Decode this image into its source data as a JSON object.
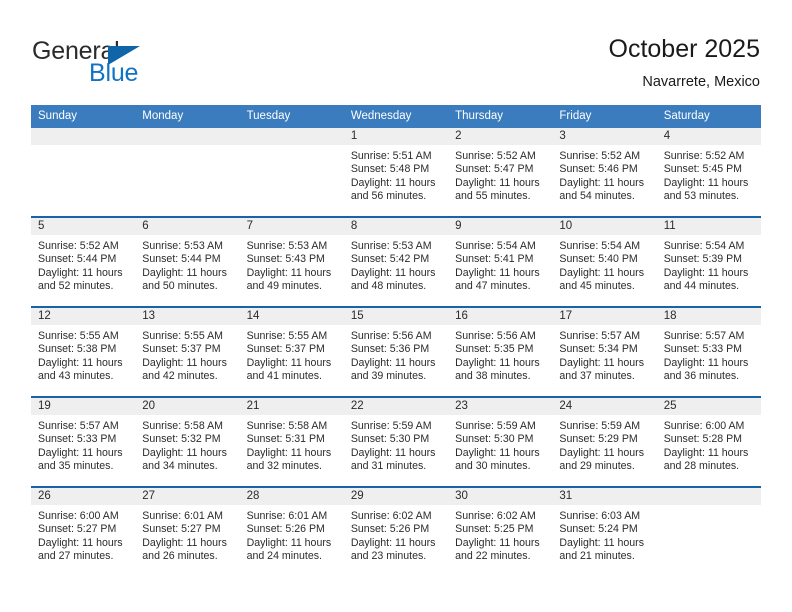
{
  "brand": {
    "word1": "General",
    "word2": "Blue",
    "triangle_icon": "triangle-icon"
  },
  "header": {
    "title": "October 2025",
    "location": "Navarrete, Mexico"
  },
  "calendar": {
    "weekday_headers": [
      "Sunday",
      "Monday",
      "Tuesday",
      "Wednesday",
      "Thursday",
      "Friday",
      "Saturday"
    ],
    "labels": {
      "sunrise_prefix": "Sunrise:",
      "sunset_prefix": "Sunset:",
      "daylight_prefix": "Daylight:"
    },
    "weeks": [
      [
        {
          "day": "",
          "sunrise": "",
          "sunset": "",
          "daylight_line1": "",
          "daylight_line2": ""
        },
        {
          "day": "",
          "sunrise": "",
          "sunset": "",
          "daylight_line1": "",
          "daylight_line2": ""
        },
        {
          "day": "",
          "sunrise": "",
          "sunset": "",
          "daylight_line1": "",
          "daylight_line2": ""
        },
        {
          "day": "1",
          "sunrise": "Sunrise: 5:51 AM",
          "sunset": "Sunset: 5:48 PM",
          "daylight_line1": "Daylight: 11 hours",
          "daylight_line2": "and 56 minutes."
        },
        {
          "day": "2",
          "sunrise": "Sunrise: 5:52 AM",
          "sunset": "Sunset: 5:47 PM",
          "daylight_line1": "Daylight: 11 hours",
          "daylight_line2": "and 55 minutes."
        },
        {
          "day": "3",
          "sunrise": "Sunrise: 5:52 AM",
          "sunset": "Sunset: 5:46 PM",
          "daylight_line1": "Daylight: 11 hours",
          "daylight_line2": "and 54 minutes."
        },
        {
          "day": "4",
          "sunrise": "Sunrise: 5:52 AM",
          "sunset": "Sunset: 5:45 PM",
          "daylight_line1": "Daylight: 11 hours",
          "daylight_line2": "and 53 minutes."
        }
      ],
      [
        {
          "day": "5",
          "sunrise": "Sunrise: 5:52 AM",
          "sunset": "Sunset: 5:44 PM",
          "daylight_line1": "Daylight: 11 hours",
          "daylight_line2": "and 52 minutes."
        },
        {
          "day": "6",
          "sunrise": "Sunrise: 5:53 AM",
          "sunset": "Sunset: 5:44 PM",
          "daylight_line1": "Daylight: 11 hours",
          "daylight_line2": "and 50 minutes."
        },
        {
          "day": "7",
          "sunrise": "Sunrise: 5:53 AM",
          "sunset": "Sunset: 5:43 PM",
          "daylight_line1": "Daylight: 11 hours",
          "daylight_line2": "and 49 minutes."
        },
        {
          "day": "8",
          "sunrise": "Sunrise: 5:53 AM",
          "sunset": "Sunset: 5:42 PM",
          "daylight_line1": "Daylight: 11 hours",
          "daylight_line2": "and 48 minutes."
        },
        {
          "day": "9",
          "sunrise": "Sunrise: 5:54 AM",
          "sunset": "Sunset: 5:41 PM",
          "daylight_line1": "Daylight: 11 hours",
          "daylight_line2": "and 47 minutes."
        },
        {
          "day": "10",
          "sunrise": "Sunrise: 5:54 AM",
          "sunset": "Sunset: 5:40 PM",
          "daylight_line1": "Daylight: 11 hours",
          "daylight_line2": "and 45 minutes."
        },
        {
          "day": "11",
          "sunrise": "Sunrise: 5:54 AM",
          "sunset": "Sunset: 5:39 PM",
          "daylight_line1": "Daylight: 11 hours",
          "daylight_line2": "and 44 minutes."
        }
      ],
      [
        {
          "day": "12",
          "sunrise": "Sunrise: 5:55 AM",
          "sunset": "Sunset: 5:38 PM",
          "daylight_line1": "Daylight: 11 hours",
          "daylight_line2": "and 43 minutes."
        },
        {
          "day": "13",
          "sunrise": "Sunrise: 5:55 AM",
          "sunset": "Sunset: 5:37 PM",
          "daylight_line1": "Daylight: 11 hours",
          "daylight_line2": "and 42 minutes."
        },
        {
          "day": "14",
          "sunrise": "Sunrise: 5:55 AM",
          "sunset": "Sunset: 5:37 PM",
          "daylight_line1": "Daylight: 11 hours",
          "daylight_line2": "and 41 minutes."
        },
        {
          "day": "15",
          "sunrise": "Sunrise: 5:56 AM",
          "sunset": "Sunset: 5:36 PM",
          "daylight_line1": "Daylight: 11 hours",
          "daylight_line2": "and 39 minutes."
        },
        {
          "day": "16",
          "sunrise": "Sunrise: 5:56 AM",
          "sunset": "Sunset: 5:35 PM",
          "daylight_line1": "Daylight: 11 hours",
          "daylight_line2": "and 38 minutes."
        },
        {
          "day": "17",
          "sunrise": "Sunrise: 5:57 AM",
          "sunset": "Sunset: 5:34 PM",
          "daylight_line1": "Daylight: 11 hours",
          "daylight_line2": "and 37 minutes."
        },
        {
          "day": "18",
          "sunrise": "Sunrise: 5:57 AM",
          "sunset": "Sunset: 5:33 PM",
          "daylight_line1": "Daylight: 11 hours",
          "daylight_line2": "and 36 minutes."
        }
      ],
      [
        {
          "day": "19",
          "sunrise": "Sunrise: 5:57 AM",
          "sunset": "Sunset: 5:33 PM",
          "daylight_line1": "Daylight: 11 hours",
          "daylight_line2": "and 35 minutes."
        },
        {
          "day": "20",
          "sunrise": "Sunrise: 5:58 AM",
          "sunset": "Sunset: 5:32 PM",
          "daylight_line1": "Daylight: 11 hours",
          "daylight_line2": "and 34 minutes."
        },
        {
          "day": "21",
          "sunrise": "Sunrise: 5:58 AM",
          "sunset": "Sunset: 5:31 PM",
          "daylight_line1": "Daylight: 11 hours",
          "daylight_line2": "and 32 minutes."
        },
        {
          "day": "22",
          "sunrise": "Sunrise: 5:59 AM",
          "sunset": "Sunset: 5:30 PM",
          "daylight_line1": "Daylight: 11 hours",
          "daylight_line2": "and 31 minutes."
        },
        {
          "day": "23",
          "sunrise": "Sunrise: 5:59 AM",
          "sunset": "Sunset: 5:30 PM",
          "daylight_line1": "Daylight: 11 hours",
          "daylight_line2": "and 30 minutes."
        },
        {
          "day": "24",
          "sunrise": "Sunrise: 5:59 AM",
          "sunset": "Sunset: 5:29 PM",
          "daylight_line1": "Daylight: 11 hours",
          "daylight_line2": "and 29 minutes."
        },
        {
          "day": "25",
          "sunrise": "Sunrise: 6:00 AM",
          "sunset": "Sunset: 5:28 PM",
          "daylight_line1": "Daylight: 11 hours",
          "daylight_line2": "and 28 minutes."
        }
      ],
      [
        {
          "day": "26",
          "sunrise": "Sunrise: 6:00 AM",
          "sunset": "Sunset: 5:27 PM",
          "daylight_line1": "Daylight: 11 hours",
          "daylight_line2": "and 27 minutes."
        },
        {
          "day": "27",
          "sunrise": "Sunrise: 6:01 AM",
          "sunset": "Sunset: 5:27 PM",
          "daylight_line1": "Daylight: 11 hours",
          "daylight_line2": "and 26 minutes."
        },
        {
          "day": "28",
          "sunrise": "Sunrise: 6:01 AM",
          "sunset": "Sunset: 5:26 PM",
          "daylight_line1": "Daylight: 11 hours",
          "daylight_line2": "and 24 minutes."
        },
        {
          "day": "29",
          "sunrise": "Sunrise: 6:02 AM",
          "sunset": "Sunset: 5:26 PM",
          "daylight_line1": "Daylight: 11 hours",
          "daylight_line2": "and 23 minutes."
        },
        {
          "day": "30",
          "sunrise": "Sunrise: 6:02 AM",
          "sunset": "Sunset: 5:25 PM",
          "daylight_line1": "Daylight: 11 hours",
          "daylight_line2": "and 22 minutes."
        },
        {
          "day": "31",
          "sunrise": "Sunrise: 6:03 AM",
          "sunset": "Sunset: 5:24 PM",
          "daylight_line1": "Daylight: 11 hours",
          "daylight_line2": "and 21 minutes."
        },
        {
          "day": "",
          "sunrise": "",
          "sunset": "",
          "daylight_line1": "",
          "daylight_line2": ""
        }
      ]
    ]
  },
  "colors": {
    "header_blue": "#3a7cbe",
    "row_divider_blue": "#1a62a8",
    "daybar_gray": "#efefef",
    "brand_blue": "#1273c4",
    "text": "#2b2b2b"
  }
}
